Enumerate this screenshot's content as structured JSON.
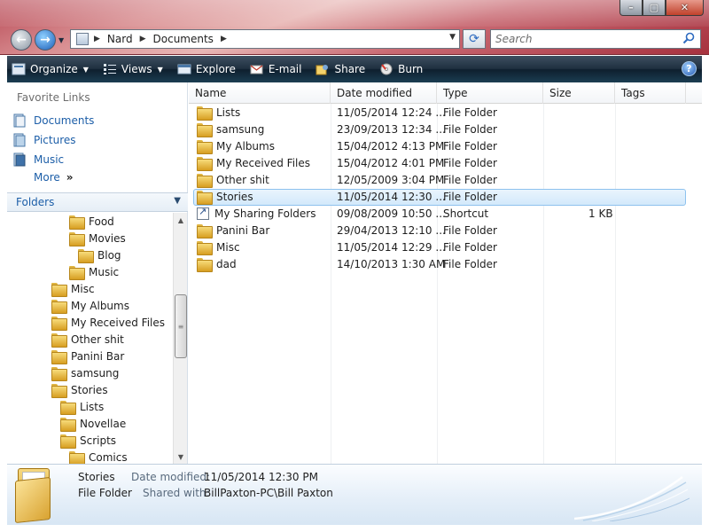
{
  "window": {
    "minimize_icon": "minimize-icon",
    "maximize_icon": "maximize-icon",
    "close_icon": "close-icon"
  },
  "nav": {
    "back_icon": "back-arrow-icon",
    "forward_icon": "forward-arrow-icon"
  },
  "address": {
    "crumbs": [
      "Nard",
      "Documents"
    ]
  },
  "search": {
    "placeholder": "Search"
  },
  "toolbar": {
    "organize": "Organize",
    "views": "Views",
    "explore": "Explore",
    "email": "E-mail",
    "share": "Share",
    "burn": "Burn",
    "help": "?"
  },
  "favorites": {
    "header": "Favorite Links",
    "items": [
      {
        "label": "Documents",
        "icon": "documents-icon"
      },
      {
        "label": "Pictures",
        "icon": "pictures-icon"
      },
      {
        "label": "Music",
        "icon": "music-icon"
      }
    ],
    "more": "More",
    "more_chevron": "»"
  },
  "folders": {
    "header": "Folders",
    "tree": [
      {
        "label": "Food",
        "level": 2
      },
      {
        "label": "Movies",
        "level": 2
      },
      {
        "label": "Blog",
        "level": 3
      },
      {
        "label": "Music",
        "level": 2
      },
      {
        "label": "Misc",
        "level": 0
      },
      {
        "label": "My Albums",
        "level": 0
      },
      {
        "label": "My Received Files",
        "level": 0
      },
      {
        "label": "Other shit",
        "level": 0
      },
      {
        "label": "Panini Bar",
        "level": 0
      },
      {
        "label": "samsung",
        "level": 0
      },
      {
        "label": "Stories",
        "level": 0
      },
      {
        "label": "Lists",
        "level": 1
      },
      {
        "label": "Novellae",
        "level": 1
      },
      {
        "label": "Scripts",
        "level": 1
      },
      {
        "label": "Comics",
        "level": 2
      }
    ]
  },
  "columns": {
    "name": "Name",
    "date": "Date modified",
    "type": "Type",
    "size": "Size",
    "tags": "Tags"
  },
  "files": [
    {
      "name": "Lists",
      "date": "11/05/2014 12:24 ...",
      "type": "File Folder",
      "size": "",
      "icon": "folder"
    },
    {
      "name": "samsung",
      "date": "23/09/2013 12:34 ...",
      "type": "File Folder",
      "size": "",
      "icon": "folder"
    },
    {
      "name": "My Albums",
      "date": "15/04/2012 4:13 PM",
      "type": "File Folder",
      "size": "",
      "icon": "folder"
    },
    {
      "name": "My Received Files",
      "date": "15/04/2012 4:01 PM",
      "type": "File Folder",
      "size": "",
      "icon": "folder"
    },
    {
      "name": "Other shit",
      "date": "12/05/2009 3:04 PM",
      "type": "File Folder",
      "size": "",
      "icon": "folder"
    },
    {
      "name": "Stories",
      "date": "11/05/2014 12:30 ...",
      "type": "File Folder",
      "size": "",
      "icon": "folder",
      "selected": true
    },
    {
      "name": "My Sharing Folders",
      "date": "09/08/2009 10:50 ...",
      "type": "Shortcut",
      "size": "1 KB",
      "icon": "shortcut"
    },
    {
      "name": "Panini Bar",
      "date": "29/04/2013 12:10 ...",
      "type": "File Folder",
      "size": "",
      "icon": "folder"
    },
    {
      "name": "Misc",
      "date": "11/05/2014 12:29 ...",
      "type": "File Folder",
      "size": "",
      "icon": "folder"
    },
    {
      "name": "dad",
      "date": "14/10/2013 1:30 AM",
      "type": "File Folder",
      "size": "",
      "icon": "folder"
    }
  ],
  "details": {
    "name": "Stories",
    "type": "File Folder",
    "date_label": "Date modified:",
    "date_value": "11/05/2014 12:30 PM",
    "shared_label": "Shared with:",
    "shared_value": "BillPaxton-PC\\Bill Paxton"
  },
  "colors": {
    "accent": "#1c5ea8",
    "toolbar_bg": "#1f3040",
    "selection": "#d3e9fb"
  }
}
